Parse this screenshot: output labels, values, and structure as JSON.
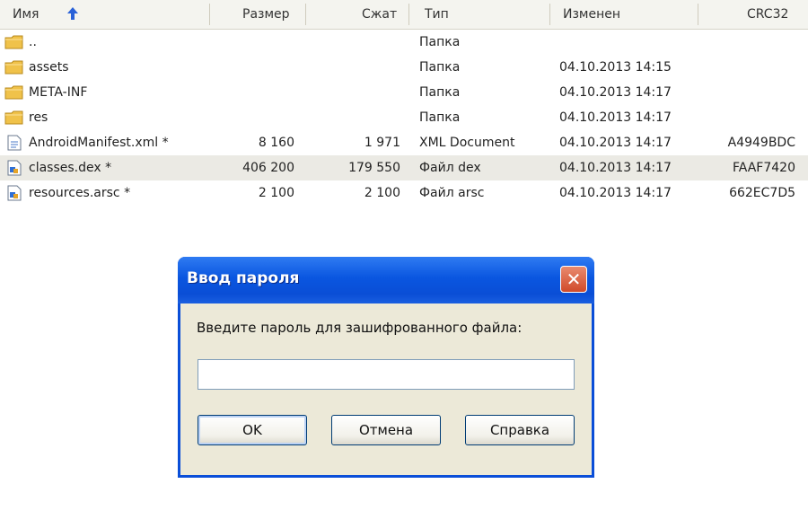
{
  "columns": {
    "name": "Имя",
    "size": "Размер",
    "packed": "Сжат",
    "type": "Тип",
    "modified": "Изменен",
    "crc": "CRC32"
  },
  "files": [
    {
      "name": "..",
      "size": "",
      "packed": "",
      "type": "Папка",
      "modified": "",
      "crc": "",
      "icon": "folder-icon"
    },
    {
      "name": "assets",
      "size": "",
      "packed": "",
      "type": "Папка",
      "modified": "04.10.2013 14:15",
      "crc": "",
      "icon": "folder-icon"
    },
    {
      "name": "META-INF",
      "size": "",
      "packed": "",
      "type": "Папка",
      "modified": "04.10.2013 14:17",
      "crc": "",
      "icon": "folder-icon"
    },
    {
      "name": "res",
      "size": "",
      "packed": "",
      "type": "Папка",
      "modified": "04.10.2013 14:17",
      "crc": "",
      "icon": "folder-icon"
    },
    {
      "name": "AndroidManifest.xml *",
      "size": "8 160",
      "packed": "1 971",
      "type": "XML Document",
      "modified": "04.10.2013 14:17",
      "crc": "A4949BDC",
      "icon": "xml-file-icon"
    },
    {
      "name": "classes.dex *",
      "size": "406 200",
      "packed": "179 550",
      "type": "Файл dex",
      "modified": "04.10.2013 14:17",
      "crc": "FAAF7420",
      "icon": "file-icon"
    },
    {
      "name": "resources.arsc *",
      "size": "2 100",
      "packed": "2 100",
      "type": "Файл arsc",
      "modified": "04.10.2013 14:17",
      "crc": "662EC7D5",
      "icon": "file-icon"
    }
  ],
  "selected_row": 5,
  "dialog": {
    "title": "Ввод пароля",
    "prompt": "Введите пароль для зашифрованного файла:",
    "password_value": "",
    "ok": "OK",
    "cancel": "Отмена",
    "help": "Справка",
    "close_glyph": "✕"
  },
  "colors": {
    "titlebar": "#0a4ed6",
    "close_button": "#d04a2a",
    "dialog_bg": "#ece9d8",
    "selected_row": "#ebeae4"
  }
}
